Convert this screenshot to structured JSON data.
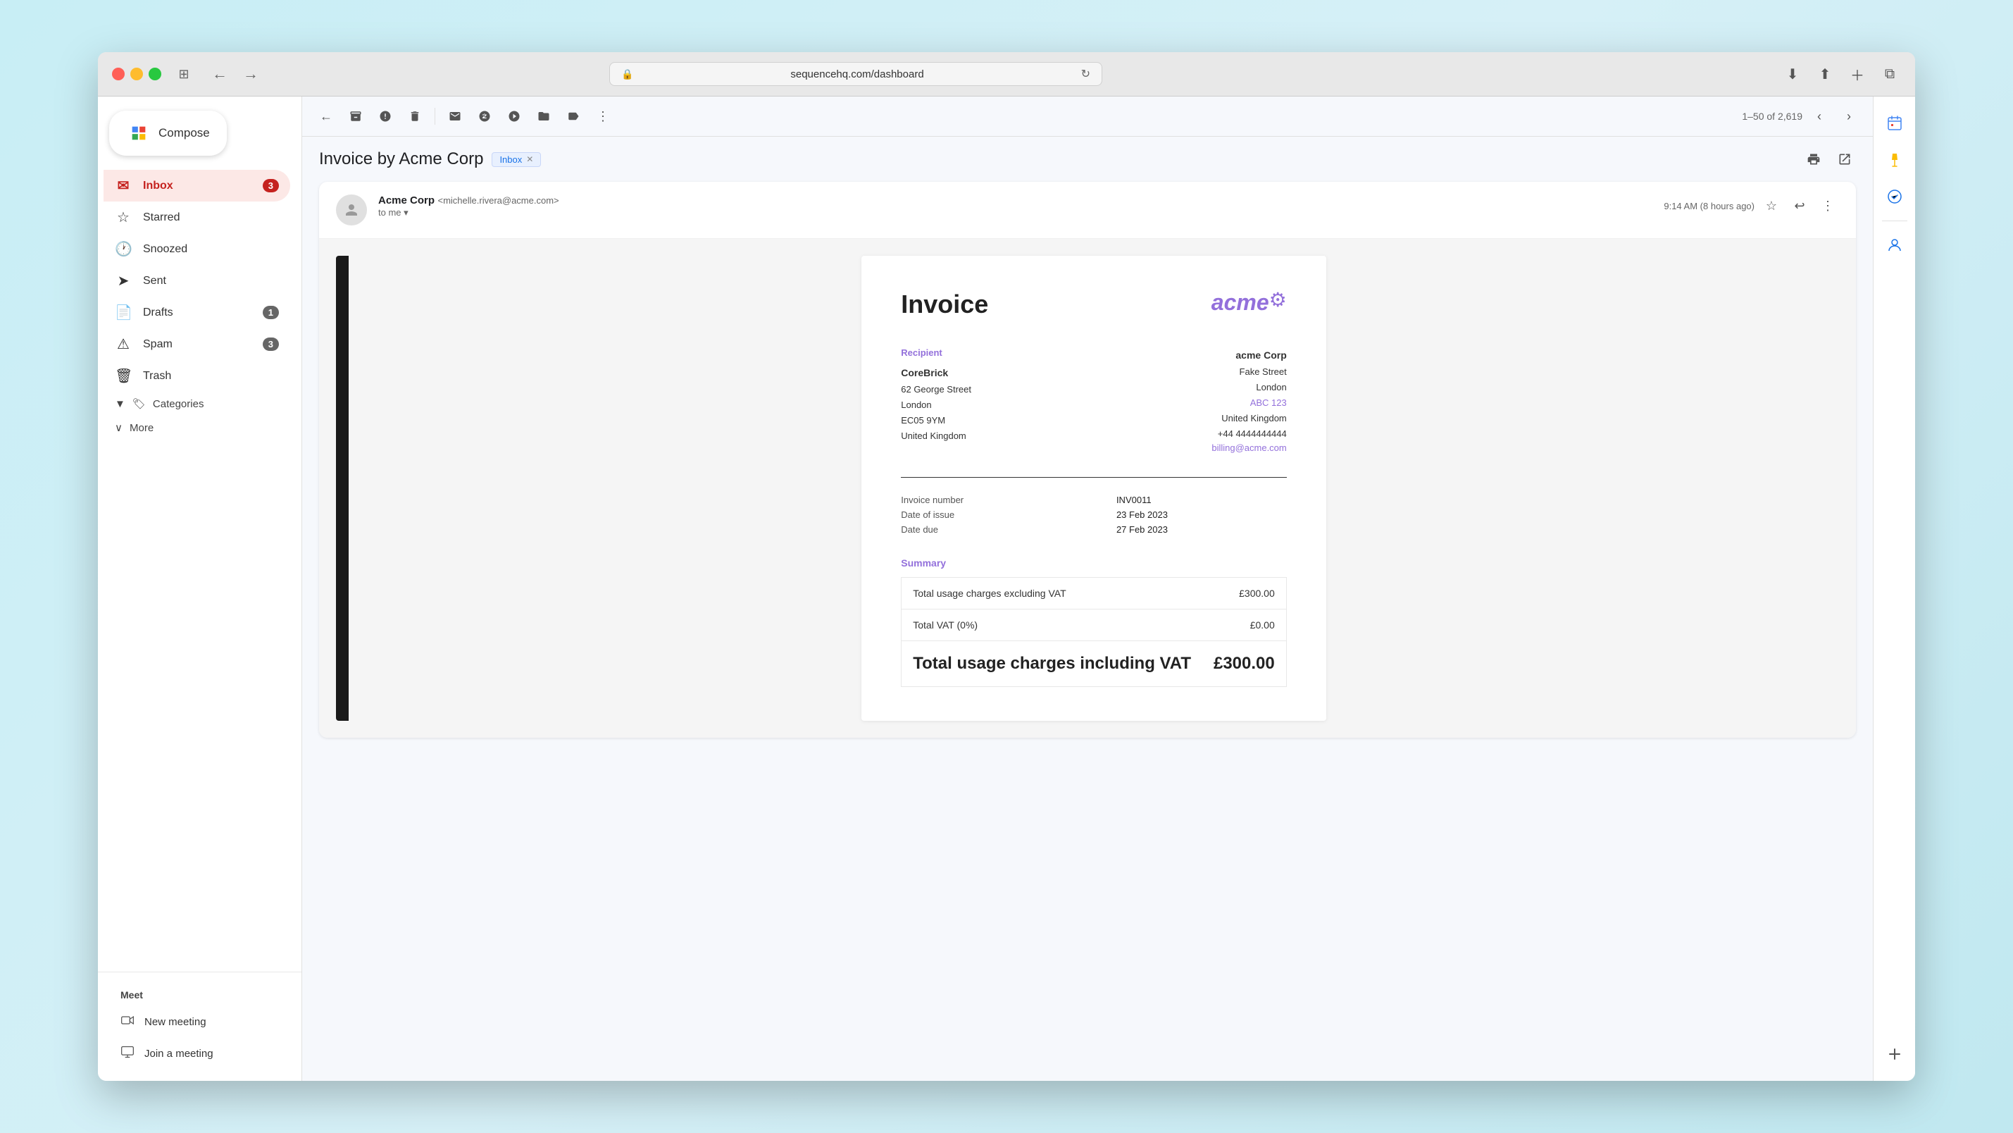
{
  "browser": {
    "url": "sequencehq.com/dashboard",
    "nav_back_label": "←",
    "nav_forward_label": "→"
  },
  "sidebar": {
    "compose_label": "Compose",
    "nav_items": [
      {
        "id": "inbox",
        "label": "Inbox",
        "icon": "✉",
        "badge": "3",
        "active": true
      },
      {
        "id": "starred",
        "label": "Starred",
        "icon": "★",
        "badge": "",
        "active": false
      },
      {
        "id": "snoozed",
        "label": "Snoozed",
        "icon": "🕐",
        "badge": "",
        "active": false
      },
      {
        "id": "sent",
        "label": "Sent",
        "icon": "➤",
        "badge": "",
        "active": false
      },
      {
        "id": "drafts",
        "label": "Drafts",
        "icon": "📄",
        "badge": "1",
        "active": false
      },
      {
        "id": "spam",
        "label": "Spam",
        "icon": "⚠",
        "badge": "3",
        "active": false
      },
      {
        "id": "trash",
        "label": "Trash",
        "icon": "🗑",
        "badge": "",
        "active": false
      }
    ],
    "categories_label": "Categories",
    "more_label": "More",
    "meet_title": "Meet",
    "meet_items": [
      {
        "id": "new-meeting",
        "label": "New meeting",
        "icon": "📹"
      },
      {
        "id": "join-meeting",
        "label": "Join a meeting",
        "icon": "📺"
      }
    ]
  },
  "toolbar": {
    "back_label": "←",
    "archive_title": "Archive",
    "report_title": "Report spam",
    "delete_title": "Delete",
    "mark_unread_title": "Mark as unread",
    "snooze_title": "Snooze",
    "move_title": "Move to",
    "label_title": "Labels",
    "more_title": "More",
    "pagination": "1–50 of 2,619",
    "prev_title": "Older",
    "next_title": "Newer"
  },
  "email": {
    "subject": "Invoice by Acme Corp",
    "label": "Inbox",
    "from_name": "Acme Corp",
    "from_email": "michelle.rivera@acme.com",
    "to": "to me",
    "time": "9:14 AM (8 hours ago)",
    "avatar_icon": "👤",
    "print_title": "Print",
    "open_title": "Open in new window"
  },
  "invoice": {
    "title": "Invoice",
    "logo_text": "acme",
    "recipient_label": "Recipient",
    "recipient_name": "CoreBrick",
    "recipient_address1": "62 George Street",
    "recipient_city": "London",
    "recipient_postcode": "EC05 9YM",
    "recipient_country": "United Kingdom",
    "sender_name": "acme Corp",
    "sender_street": "Fake Street",
    "sender_city": "London",
    "sender_postcode": "ABC 123",
    "sender_country": "United Kingdom",
    "sender_phone": "+44 4444444444",
    "sender_email": "billing@acme.com",
    "invoice_number_label": "Invoice number",
    "invoice_number": "INV0011",
    "date_issue_label": "Date of issue",
    "date_issue": "23 Feb 2023",
    "date_due_label": "Date due",
    "date_due": "27 Feb 2023",
    "summary_label": "Summary",
    "line1_label": "Total usage charges excluding VAT",
    "line1_value": "£300.00",
    "line2_label": "Total VAT (0%)",
    "line2_value": "£0.00",
    "line3_label": "Total usage charges including VAT",
    "line3_value": "£300.00"
  },
  "right_sidebar": {
    "calendar_icon": "calendar",
    "keep_icon": "keep",
    "tasks_icon": "tasks",
    "contacts_icon": "contacts",
    "add_icon": "add"
  }
}
